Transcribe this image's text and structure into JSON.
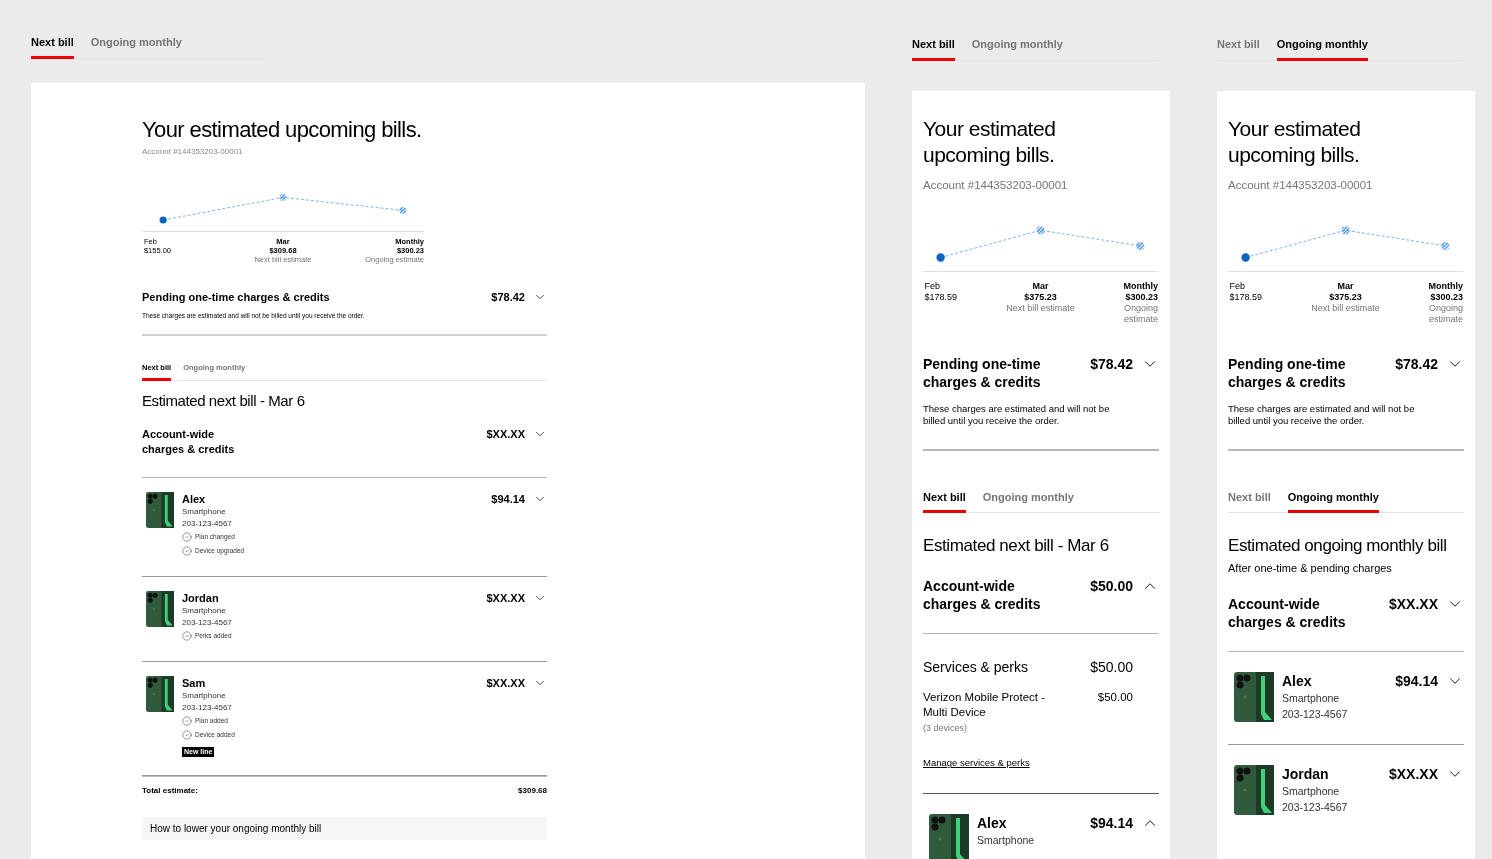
{
  "views": [
    {
      "kind": "wide",
      "tabs": [
        {
          "label": "Next bill",
          "selected": true
        },
        {
          "label": "Ongoing monthly",
          "selected": false
        }
      ],
      "title": "Your estimated upcoming bills.",
      "account": "Account #144353203-00001",
      "chart_labels": [
        {
          "kind": "actual",
          "label": "Feb",
          "amount": "$155.00"
        },
        {
          "kind": "estimate",
          "label": "Mar",
          "amount": "$309.68",
          "note": "Next bill estimate"
        },
        {
          "kind": "estimate",
          "label": "Monthly",
          "amount": "$300.23",
          "note": "Ongoing estimate"
        }
      ],
      "pending": {
        "title": "Pending one-time charges & credits",
        "amount": "$78.42",
        "expanded": false,
        "note": "These charges are estimated and will not be billed until you receive the order."
      },
      "bill_tabs": [
        {
          "label": "Next bill",
          "selected": true
        },
        {
          "label": "Ongoing monthly",
          "selected": false
        }
      ],
      "bill": {
        "title": "Estimated next bill - Mar 6"
      },
      "account_wide": {
        "title": "Account-wide charges & credits",
        "amount": "$XX.XX",
        "expanded": false
      },
      "lines": [
        {
          "name": "Alex",
          "device": "Smartphone",
          "number": "203-123-4567",
          "amount": "$94.14",
          "expanded": false,
          "changes": [
            "Plan changed",
            "Device upgraded"
          ]
        },
        {
          "name": "Jordan",
          "device": "Smartphone",
          "number": "203-123-4567",
          "amount": "$XX.XX",
          "expanded": false,
          "changes": [
            "Perks added"
          ]
        },
        {
          "name": "Sam",
          "device": "Smartphone",
          "number": "203-123-4567",
          "amount": "$XX.XX",
          "expanded": false,
          "changes": [
            "Plan added",
            "Device added"
          ],
          "badge": "New line"
        }
      ],
      "total": {
        "label": "Total estimate:",
        "amount": "$309.68"
      },
      "tip": "How to lower your ongoing monthly bill"
    },
    {
      "kind": "narrow",
      "tabs": [
        {
          "label": "Next bill",
          "selected": true
        },
        {
          "label": "Ongoing monthly",
          "selected": false
        }
      ],
      "title": "Your estimated upcoming bills.",
      "account": "Account #144353203-00001",
      "chart_labels": [
        {
          "kind": "actual",
          "label": "Feb",
          "amount": "$178.59"
        },
        {
          "kind": "estimate",
          "label": "Mar",
          "amount": "$375.23",
          "note": "Next bill estimate"
        },
        {
          "kind": "estimate",
          "label": "Monthly",
          "amount": "$300.23",
          "note": "Ongoing estimate"
        }
      ],
      "pending": {
        "title": "Pending one-time charges & credits",
        "amount": "$78.42",
        "expanded": false,
        "note": "These charges are estimated and will not be billed until you receive the order."
      },
      "bill_tabs": [
        {
          "label": "Next bill",
          "selected": true
        },
        {
          "label": "Ongoing monthly",
          "selected": false
        }
      ],
      "bill": {
        "title": "Estimated next bill - Mar  6"
      },
      "account_wide": {
        "title": "Account-wide charges & credits",
        "amount": "$50.00",
        "expanded": true,
        "section": {
          "title": "Services & perks",
          "amount": "$50.00"
        },
        "items": [
          {
            "name": "Verizon Mobile Protect - Multi Device",
            "amount": "$50.00",
            "note": "(3 devices)"
          }
        ],
        "link": "Manage services & perks"
      },
      "lines": [
        {
          "name": "Alex",
          "device": "Smartphone",
          "amount": "$94.14",
          "expanded": true
        }
      ]
    },
    {
      "kind": "narrow",
      "tabs": [
        {
          "label": "Next bill",
          "selected": false
        },
        {
          "label": "Ongoing monthly",
          "selected": true
        }
      ],
      "title": "Your estimated upcoming bills.",
      "account": "Account #144353203-00001",
      "chart_labels": [
        {
          "kind": "actual",
          "label": "Feb",
          "amount": "$178.59"
        },
        {
          "kind": "estimate",
          "label": "Mar",
          "amount": "$375.23",
          "note": "Next bill estimate"
        },
        {
          "kind": "estimate",
          "label": "Monthly",
          "amount": "$300.23",
          "note": "Ongoing estimate"
        }
      ],
      "pending": {
        "title": "Pending one-time charges & credits",
        "amount": "$78.42",
        "expanded": false,
        "note": "These charges are estimated and will not be billed until you receive the order."
      },
      "bill_tabs": [
        {
          "label": "Next bill",
          "selected": false
        },
        {
          "label": "Ongoing monthly",
          "selected": true
        }
      ],
      "bill": {
        "title": "Estimated ongoing monthly bill",
        "subtitle": "After one-time & pending charges"
      },
      "account_wide": {
        "title": "Account-wide charges & credits",
        "amount": "$XX.XX",
        "expanded": false
      },
      "lines": [
        {
          "name": "Alex",
          "device": "Smartphone",
          "number": "203-123-4567",
          "amount": "$94.14",
          "expanded": false
        },
        {
          "name": "Jordan",
          "device": "Smartphone",
          "number": "203-123-4567",
          "amount": "$XX.XX",
          "expanded": false
        }
      ]
    }
  ]
}
